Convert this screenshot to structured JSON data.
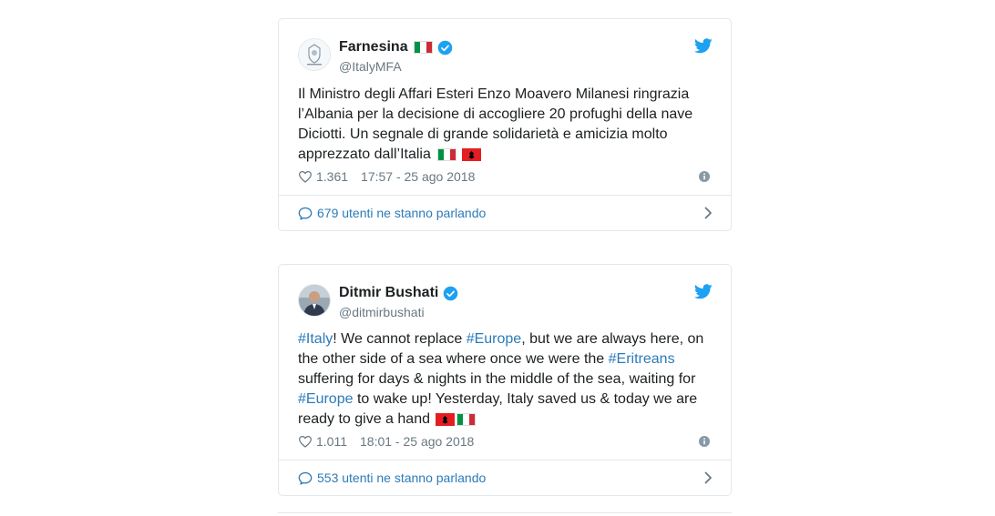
{
  "colors": {
    "link": "#2b7bb9",
    "muted": "#697882",
    "twitter_blue": "#1da1f2",
    "border": "#e1e8ed"
  },
  "tweets": [
    {
      "display_name": "Farnesina",
      "handle": "@ItalyMFA",
      "flags": [
        "italy-flag"
      ],
      "verified": true,
      "avatar_icon": "farnesina-emblem-icon",
      "text_lines": [
        "Il Ministro degli Affari Esteri Enzo Moavero Milanesi ringrazia",
        "l’Albania per la decisione di accogliere 20 profughi della nave",
        "Diciotti. Un segnale di grande solidarietà e amicizia molto",
        "apprezzato dall’Italia"
      ],
      "trailing_flags": [
        "italy-flag",
        "albania-flag"
      ],
      "likes": "1.361",
      "timestamp": "17:57 - 25 ago 2018",
      "conversation": "679 utenti ne stanno parlando"
    },
    {
      "display_name": "Ditmir Bushati",
      "handle": "@ditmirbushati",
      "flags": [],
      "verified": true,
      "avatar_icon": "user-photo-icon",
      "text_parts": {
        "h1": "#Italy",
        "t1": "! We cannot replace ",
        "h2": "#Europe",
        "t2": ", but we are always here, on",
        "t3": "the other side of a sea where once we were the ",
        "h3": "#Eritreans",
        "t4": "suffering for days & nights in the middle of the sea, waiting for",
        "h4": "#Europe",
        "t5": " to wake up! Yesterday, Italy saved us & today we are",
        "t6": "ready to give a hand"
      },
      "trailing_flags": [
        "albania-flag",
        "italy-flag"
      ],
      "likes": "1.011",
      "timestamp": "18:01 - 25 ago 2018",
      "conversation": "553 utenti ne stanno parlando"
    }
  ]
}
